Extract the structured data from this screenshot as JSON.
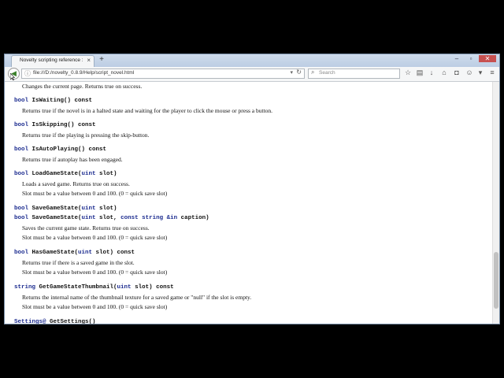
{
  "browser": {
    "tab_title": "Novelty scripting reference : N...",
    "tab_close": "×",
    "new_tab": "+",
    "url": "file:///D:/novelty_0.8.9/Help/script_novel.html",
    "search_placeholder": "Search",
    "win_minimize": "–",
    "win_maximize": "▫",
    "win_close": "✕"
  },
  "doc": {
    "top_desc": "Changes the current page. Returns true on success.",
    "entries": [
      {
        "sig": [
          [
            "bool",
            "kw"
          ],
          [
            " IsWaiting() const",
            ""
          ]
        ],
        "desc": [
          "Returns true if the novel is in a halted state and waiting for the player to click the mouse or press a button."
        ]
      },
      {
        "sig": [
          [
            "bool",
            "kw"
          ],
          [
            " IsSkipping() const",
            ""
          ]
        ],
        "desc": [
          "Returns true if the playing is pressing the skip-button."
        ]
      },
      {
        "sig": [
          [
            "bool",
            "kw"
          ],
          [
            " IsAutoPlaying() const",
            ""
          ]
        ],
        "desc": [
          "Returns true if autoplay has been engaged."
        ]
      },
      {
        "sig": [
          [
            "bool",
            "kw"
          ],
          [
            " LoadGameState(",
            ""
          ],
          [
            "uint",
            "kw"
          ],
          [
            " slot)",
            ""
          ]
        ],
        "desc": [
          "Loads a saved game. Returns true on success.",
          "Slot must be a value between 0 and 100. (0 = quick save slot)"
        ]
      },
      {
        "sig": [
          [
            "bool",
            "kw"
          ],
          [
            " SaveGameState(",
            ""
          ],
          [
            "uint",
            "kw"
          ],
          [
            " slot)",
            ""
          ]
        ],
        "sig2": [
          [
            "bool",
            "kw"
          ],
          [
            " SaveGameState(",
            ""
          ],
          [
            "uint",
            "kw"
          ],
          [
            " slot, ",
            ""
          ],
          [
            "const string",
            "kw"
          ],
          [
            " ",
            ""
          ],
          [
            "&in",
            "kw"
          ],
          [
            " caption)",
            ""
          ]
        ],
        "desc": [
          "Saves the current game state. Returns true on success.",
          "Slot must be a value between 0 and 100. (0 = quick save slot)"
        ]
      },
      {
        "sig": [
          [
            "bool",
            "kw"
          ],
          [
            " HasGameState(",
            ""
          ],
          [
            "uint",
            "kw"
          ],
          [
            " slot) const",
            ""
          ]
        ],
        "desc": [
          "Returns true if there is a saved game in the slot.",
          "Slot must be a value between 0 and 100. (0 = quick save slot)"
        ]
      },
      {
        "sig": [
          [
            "string",
            "kw"
          ],
          [
            " GetGameStateThumbnail(",
            ""
          ],
          [
            "uint",
            "kw"
          ],
          [
            " slot) const",
            ""
          ]
        ],
        "desc": [
          "Returns the internal name of the thumbnail texture for a saved game or \"null\" if the slot is empty.",
          "Slot must be a value between 0 and 100. (0 = quick save slot)"
        ]
      },
      {
        "sig": [
          [
            "Settings@",
            "kw"
          ],
          [
            " GetSettings()",
            ""
          ]
        ],
        "desc": []
      }
    ]
  }
}
